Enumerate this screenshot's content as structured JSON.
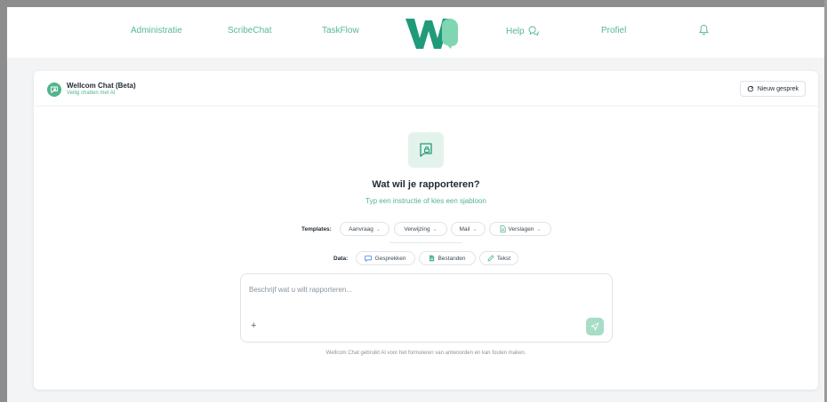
{
  "nav": {
    "items": [
      {
        "label": "Administratie"
      },
      {
        "label": "ScribeChat"
      },
      {
        "label": "TaskFlow"
      },
      {
        "label": "Help"
      },
      {
        "label": "Profiel"
      }
    ],
    "logo_icon": "wellcom-logo",
    "help_icon": "chat-bubbles-icon",
    "bell_icon": "bell-icon"
  },
  "chat": {
    "brand_title": "Wellcom Chat (Beta)",
    "brand_subtitle": "Veilig chatten met AI",
    "new_chat_label": "Nieuw gesprek",
    "headline": "Wat wil je rapporteren?",
    "subline": "Typ een instructie of kies een sjabloon",
    "templates_label": "Templates:",
    "templates": [
      {
        "label": "Aanvraag"
      },
      {
        "label": "Verwijzing"
      },
      {
        "label": "Mail"
      },
      {
        "label": "Verslagen"
      }
    ],
    "data_label": "Data:",
    "data_sources": [
      {
        "label": "Gesprekken",
        "icon": "chat-icon"
      },
      {
        "label": "Bestanden",
        "icon": "document-icon"
      },
      {
        "label": "Tekst",
        "icon": "pencil-icon"
      }
    ],
    "input_placeholder": "Beschrijf wat u wilt rapporteren...",
    "input_value": "",
    "add_label": "+",
    "disclaimer": "Wellcom Chat gebruikt AI voor het formuleren van antwoorden en kan fouten maken."
  },
  "colors": {
    "accent": "#52b48d",
    "accent_dark": "#1f9b7a",
    "accent_light": "#e3f3ec",
    "send_disabled": "#a7ddc6"
  }
}
